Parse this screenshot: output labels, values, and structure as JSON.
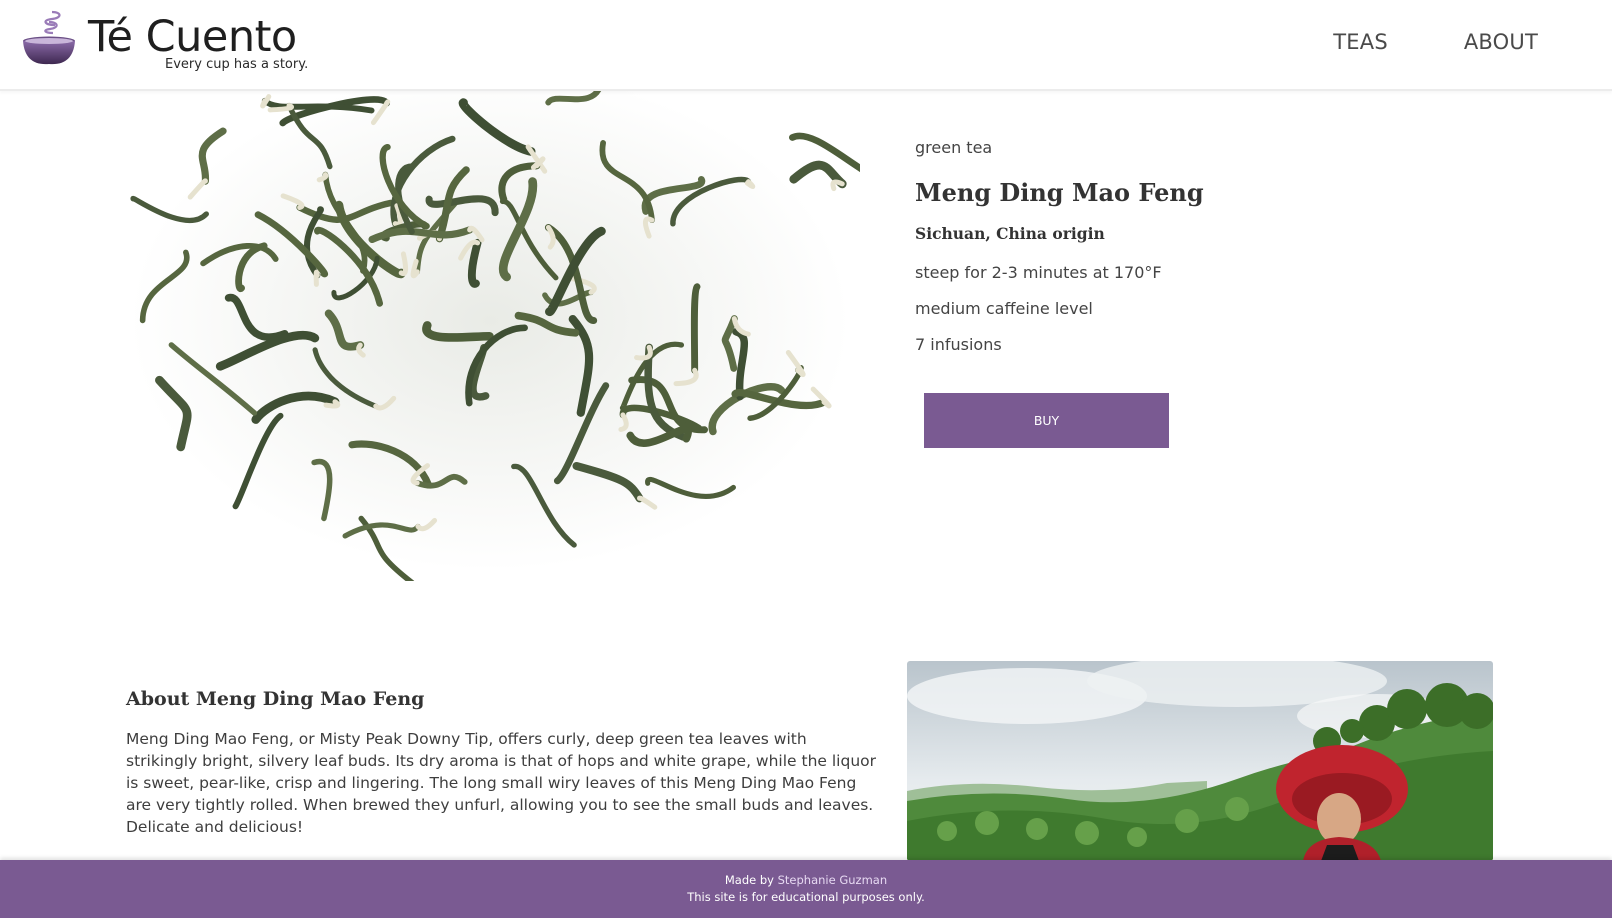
{
  "header": {
    "brand_name": "Té Cuento",
    "tagline": "Every cup has a story.",
    "nav": [
      {
        "label": "TEAS"
      },
      {
        "label": "ABOUT"
      }
    ]
  },
  "product": {
    "category": "green tea",
    "name": "Meng Ding Mao Feng",
    "origin": "Sichuan, China origin",
    "steep": "steep for 2-3 minutes at 170°F",
    "caffeine": "medium caffeine level",
    "infusions": "7 infusions",
    "buy_label": "BUY"
  },
  "about": {
    "title": "About Meng Ding Mao Feng",
    "text": "Meng Ding Mao Feng, or Misty Peak Downy Tip, offers curly, deep green tea leaves with strikingly bright, silvery leaf buds. Its dry aroma is that of hops and white grape, while the liquor is sweet, pear-like, crisp and lingering. The long small wiry leaves of this Meng Ding Mao Feng are very tightly rolled. When brewed they unfurl, allowing you to see the small buds and leaves. Delicate and delicious!"
  },
  "footer": {
    "made_by_prefix": "Made by",
    "author_name": "Stephanie Guzman",
    "disclaimer": "This site is for educational purposes only."
  },
  "theme": {
    "accent": "#7a5a92",
    "text": "#3a3a3a"
  },
  "icons": {
    "logo": "tea-cup-logo-icon"
  }
}
